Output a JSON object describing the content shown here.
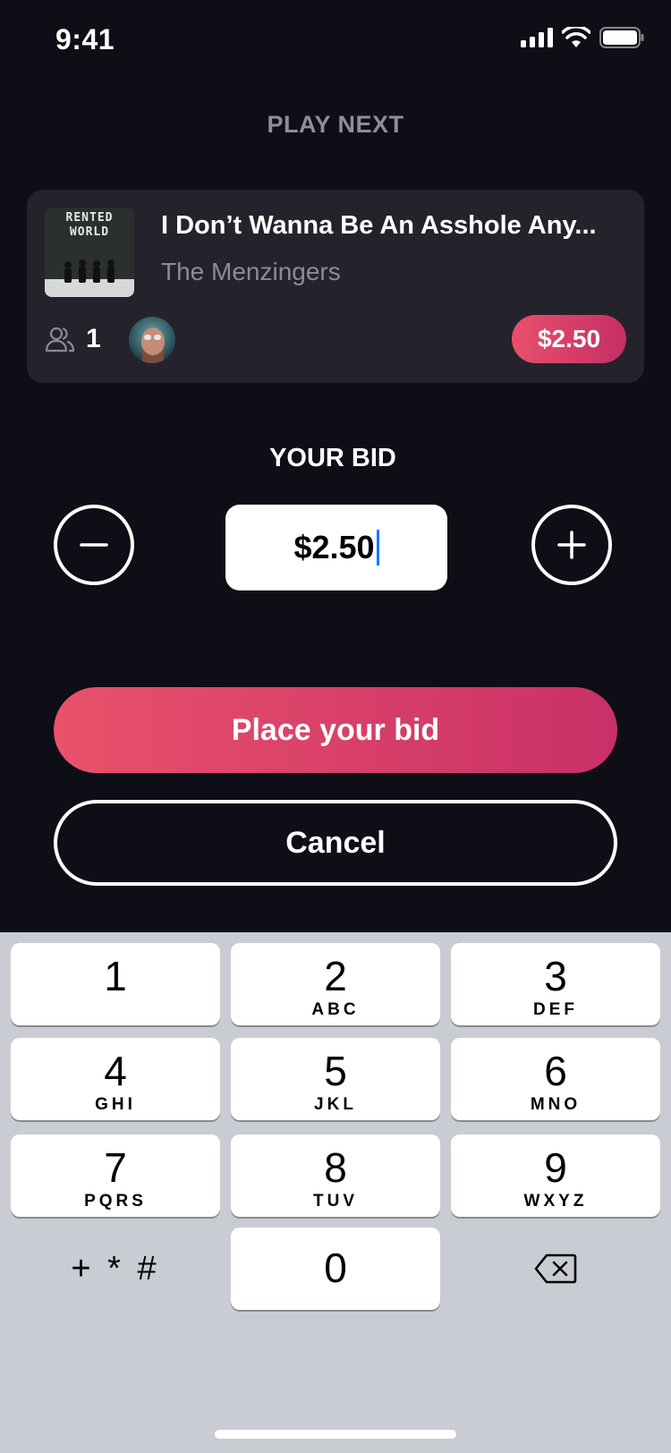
{
  "status_bar": {
    "time": "9:41"
  },
  "header": {
    "title": "PLAY NEXT"
  },
  "track": {
    "cover_text": "RENTED WORLD",
    "title": "I Don’t Wanna Be An Asshole Any...",
    "artist": "The Menzingers",
    "bidders": "1",
    "price": "$2.50"
  },
  "bid": {
    "label": "YOUR BID",
    "value": "$2.50"
  },
  "actions": {
    "place_bid": "Place your bid",
    "cancel": "Cancel"
  },
  "keypad": {
    "keys": [
      {
        "num": "1",
        "letters": ""
      },
      {
        "num": "2",
        "letters": "ABC"
      },
      {
        "num": "3",
        "letters": "DEF"
      },
      {
        "num": "4",
        "letters": "GHI"
      },
      {
        "num": "5",
        "letters": "JKL"
      },
      {
        "num": "6",
        "letters": "MNO"
      },
      {
        "num": "7",
        "letters": "PQRS"
      },
      {
        "num": "8",
        "letters": "TUV"
      },
      {
        "num": "9",
        "letters": "WXYZ"
      },
      {
        "num": "0",
        "letters": ""
      }
    ],
    "symbols": "+ * #"
  },
  "colors": {
    "background": "#0e0e16",
    "card": "#24232c",
    "accent_start": "#e8526a",
    "accent_end": "#c93068",
    "keyboard_bg": "#c9ccd3",
    "caret": "#1479ff"
  },
  "icons": [
    "signal-icon",
    "wifi-icon",
    "battery-icon",
    "people-icon",
    "minus-icon",
    "plus-icon",
    "backspace-icon"
  ]
}
